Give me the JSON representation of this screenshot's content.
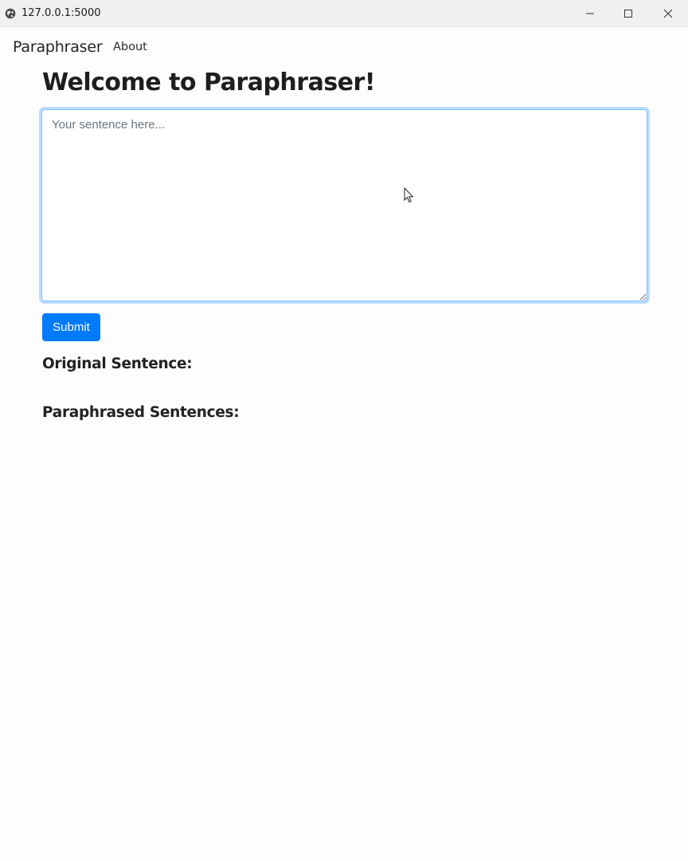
{
  "window": {
    "title": "127.0.0.1:5000",
    "icons": {
      "site": "globe-icon",
      "minimize": "minimize-icon",
      "maximize": "maximize-icon",
      "close": "close-icon"
    }
  },
  "navbar": {
    "brand": "Paraphraser",
    "links": [
      {
        "label": "About"
      }
    ]
  },
  "main": {
    "title": "Welcome to Paraphraser!",
    "sentence_input": {
      "value": "",
      "placeholder": "Your sentence here..."
    },
    "submit_label": "Submit",
    "original_heading": "Original Sentence:",
    "paraphrased_heading": "Paraphrased Sentences:"
  },
  "colors": {
    "primary": "#007bff",
    "focus_border": "#80bdff",
    "text": "#212529"
  }
}
